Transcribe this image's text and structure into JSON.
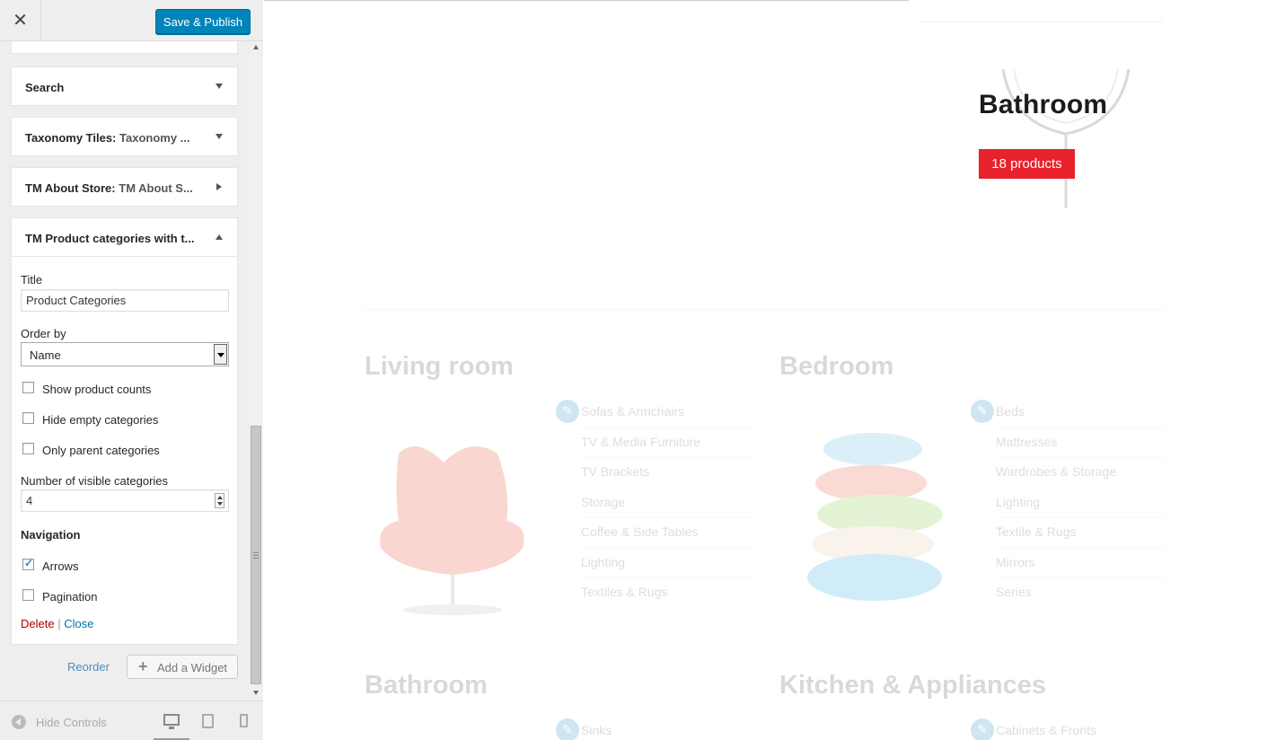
{
  "header": {
    "close_glyph": "✕",
    "save_label": "Save & Publish"
  },
  "widgets": [
    {
      "title": "Search",
      "subtitle": "",
      "state": "collapsed"
    },
    {
      "title": "Taxonomy Tiles:",
      "subtitle": "Taxonomy ...",
      "state": "collapsed"
    },
    {
      "title": "TM About Store:",
      "subtitle": "TM About S...",
      "state": "collapsed"
    },
    {
      "title": "TM Product categories with t...",
      "subtitle": "",
      "state": "expanded"
    }
  ],
  "form": {
    "title_label": "Title",
    "title_value": "Product Categories",
    "order_label": "Order by",
    "order_value": "Name",
    "show_counts_label": "Show product counts",
    "show_counts_checked": false,
    "hide_empty_label": "Hide empty categories",
    "hide_empty_checked": false,
    "only_parent_label": "Only parent categories",
    "only_parent_checked": false,
    "visible_label": "Number of visible categories",
    "visible_value": "4",
    "navigation_heading": "Navigation",
    "arrows_label": "Arrows",
    "arrows_checked": true,
    "pagination_label": "Pagination",
    "pagination_checked": false,
    "delete_label": "Delete",
    "separator": "|",
    "close_label": "Close"
  },
  "sidebar_actions": {
    "reorder_label": "Reorder",
    "add_widget_plus": "+",
    "add_widget_label": "Add a Widget"
  },
  "footer": {
    "hide_controls_label": "Hide Controls",
    "devices": [
      "desktop-icon",
      "tablet-icon",
      "mobile-icon"
    ],
    "active_device": "desktop"
  },
  "preview": {
    "hero_category": "Bathroom",
    "hero_badge": "18 products",
    "accent_color": "#e8222c",
    "categories": [
      {
        "name": "Living room",
        "subcategories": [
          "Sofas & Armchairs",
          "TV & Media Furniture",
          "TV Brackets",
          "Storage",
          "Coffee & Side Tables",
          "Lighting",
          "Textiles & Rugs"
        ]
      },
      {
        "name": "Bedroom",
        "subcategories": [
          "Beds",
          "Mattresses",
          "Wardrobes & Storage",
          "Lighting",
          "Textile & Rugs",
          "Mirrors",
          "Series"
        ]
      },
      {
        "name": "Bathroom",
        "subcategories": [
          "Sinks"
        ]
      },
      {
        "name": "Kitchen & Appliances",
        "subcategories": [
          "Cabinets & Fronts"
        ]
      }
    ]
  }
}
